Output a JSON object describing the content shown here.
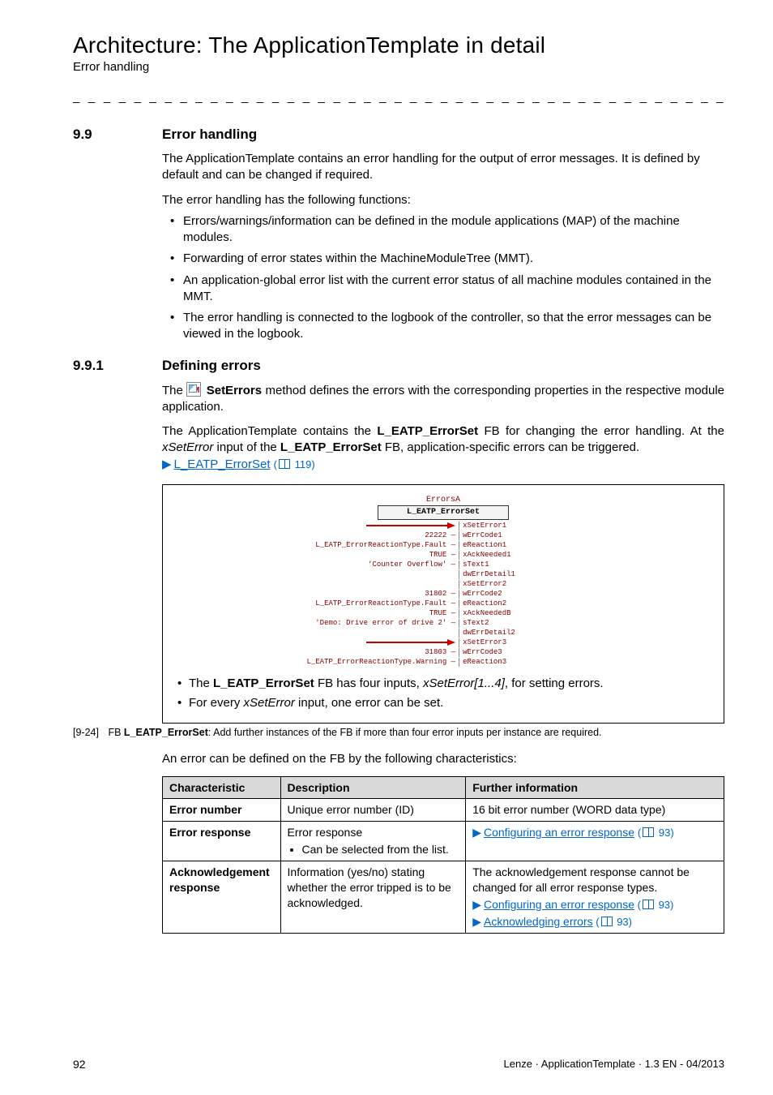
{
  "header": {
    "title": "Architecture: The ApplicationTemplate in detail",
    "subtitle": "Error handling"
  },
  "section1": {
    "num": "9.9",
    "title": "Error handling",
    "p1": "The ApplicationTemplate contains an error handling for the output of error messages. It is defined by default and can be changed if required.",
    "p2": "The error handling has the following functions:",
    "bullets": [
      "Errors/warnings/information can be defined in the module applications (MAP) of the machine modules.",
      "Forwarding of error states within the MachineModuleTree (MMT).",
      "An application-global error list with the current error status of all machine modules contained in the MMT.",
      "The error handling is connected to the logbook of the controller, so that the error messages can be viewed in the logbook."
    ]
  },
  "section2": {
    "num": "9.9.1",
    "title": "Defining errors",
    "p1a": "The ",
    "method": "SetErrors",
    "p1b": " method defines the errors with the corresponding properties in the respective module application.",
    "p2a": "The ApplicationTemplate contains the ",
    "fb": "L_EATP_ErrorSet",
    "p2b": " FB for changing the error handling. At the ",
    "input": "xSetError",
    "p2c": " input of the ",
    "p2d": " FB, application-specific errors can be triggered.",
    "link_text": "L_EATP_ErrorSet",
    "link_page": "119"
  },
  "diagram": {
    "caption_label": "ErrorsA",
    "fb_title": "L_EATP_ErrorSet",
    "rows": [
      {
        "left_arrow": true,
        "right": "xSetError1"
      },
      {
        "left": "22222",
        "right": "wErrCode1"
      },
      {
        "left": "L_EATP_ErrorReactionType.Fault",
        "right": "eReaction1"
      },
      {
        "left": "TRUE",
        "right": "xAckNeeded1"
      },
      {
        "left": "'Counter Overflow'",
        "right": "sText1"
      },
      {
        "left": "",
        "right": "dwErrDetail1"
      },
      {
        "left": "",
        "right": "xSetError2"
      },
      {
        "left": "31802",
        "right": "wErrCode2"
      },
      {
        "left": "L_EATP_ErrorReactionType.Fault",
        "right": "eReaction2"
      },
      {
        "left": "TRUE",
        "right": "xAckNeededB"
      },
      {
        "left": "'Demo: Drive error of drive 2'",
        "right": "sText2"
      },
      {
        "left": "",
        "right": "dwErrDetail2"
      },
      {
        "left_arrow": true,
        "right": "xSetError3"
      },
      {
        "left": "31803",
        "right": "wErrCode3"
      },
      {
        "left": "L_EATP_ErrorReactionType.Warning",
        "right": "eReaction3"
      }
    ],
    "b1a": "The ",
    "b1fb": "L_EATP_ErrorSet",
    "b1b": " FB has four inputs, ",
    "b1i": "xSetError[1...4]",
    "b1c": ", for setting errors.",
    "b2a": "For every ",
    "b2i": "xSetError",
    "b2b": " input, one error can be set."
  },
  "figcaption": {
    "num": "[9-24]",
    "fb": "L_EATP_ErrorSet",
    "rest": ": Add further instances of the FB if more than four error inputs per instance are required."
  },
  "tableintro": "An error can be defined on the FB by the following characteristics:",
  "table": {
    "head": [
      "Characteristic",
      "Description",
      "Further information"
    ],
    "rows": [
      {
        "c": "Error number",
        "d": "Unique error number (ID)",
        "f": "16 bit error number (WORD data type)"
      },
      {
        "c": "Error response",
        "d_main": "Error response",
        "d_sub": "Can be selected from the list.",
        "f_link": "Configuring an error response",
        "f_page": "93"
      },
      {
        "c": "Acknowledgement response",
        "d": "Information (yes/no) stating whether the error tripped is to be acknowledged.",
        "f_text": "The acknowledgement response cannot be changed for all error response types.",
        "f_link1": "Configuring an error response",
        "f_page1": "93",
        "f_link2": "Acknowledging errors",
        "f_page2": "93"
      }
    ]
  },
  "footer": {
    "page": "92",
    "doc": "Lenze · ApplicationTemplate · 1.3 EN - 04/2013"
  }
}
